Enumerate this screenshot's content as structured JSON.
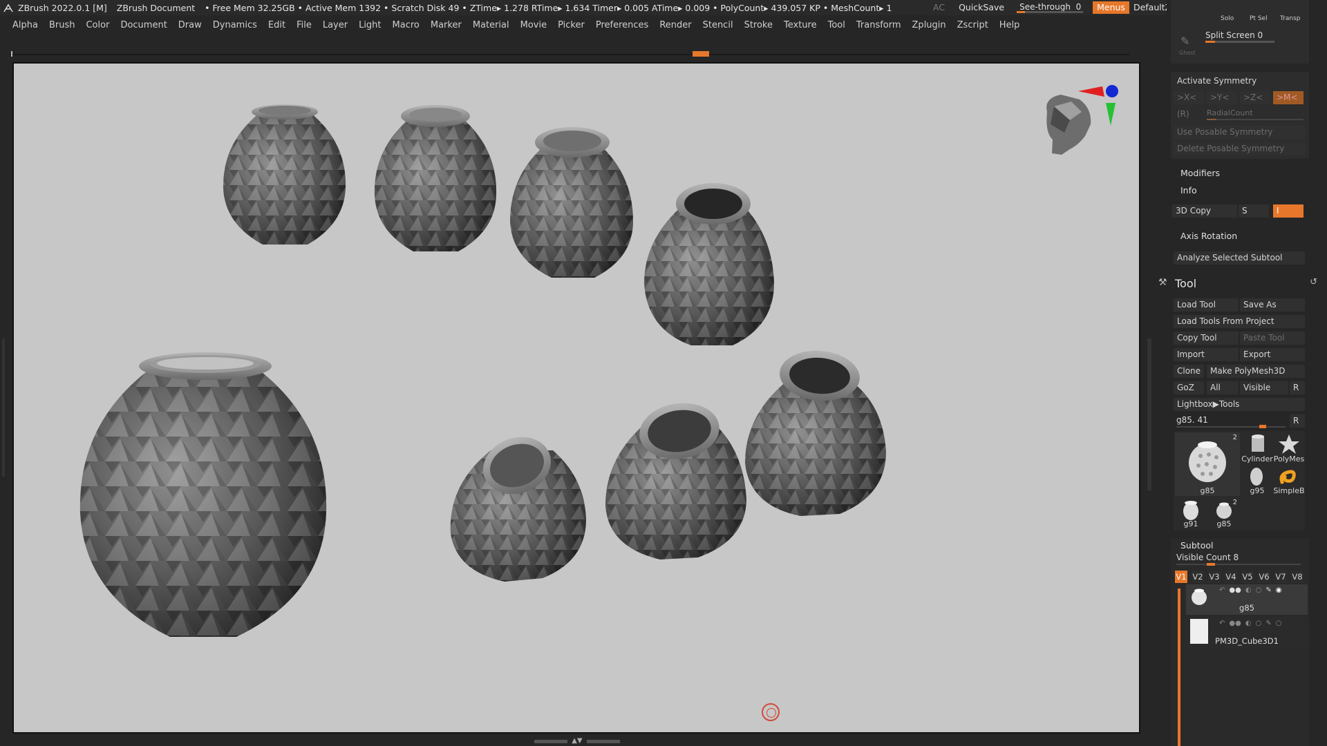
{
  "titlebar": {
    "app": "ZBrush 2022.0.1 [M]",
    "document": "ZBrush Document",
    "status": "• Free Mem 32.25GB • Active Mem 1392 • Scratch Disk 49 • ZTime▸ 1.278 RTime▸ 1.634 Timer▸ 0.005 ATime▸ 0.009 • PolyCount▸ 439.057 KP • MeshCount▸ 1",
    "ac": "AC",
    "quicksave": "QuickSave",
    "seethrough_label": "See-through",
    "seethrough_value": "0",
    "seethrough_level": 0,
    "menus": "Menus",
    "script": "DefaultZScript"
  },
  "menubar": [
    "Alpha",
    "Brush",
    "Color",
    "Document",
    "Draw",
    "Dynamics",
    "Edit",
    "File",
    "Layer",
    "Light",
    "Macro",
    "Marker",
    "Material",
    "Movie",
    "Picker",
    "Preferences",
    "Render",
    "Stencil",
    "Stroke",
    "Texture",
    "Tool",
    "Transform",
    "Zplugin",
    "Zscript",
    "Help"
  ],
  "top_right_panel": {
    "solo": "Solo",
    "ptsel": "Pt Sel",
    "transp": "Transp",
    "ghost": "Ghost",
    "split_screen_label": "Split Screen",
    "split_screen_value": "0"
  },
  "symmetry": {
    "title": "Activate Symmetry",
    "x": ">X<",
    "y": ">Y<",
    "z": ">Z<",
    "m": ">M<",
    "r": "(R)",
    "radial": "RadialCount",
    "use_posable": "Use Posable Symmetry",
    "delete_posable": "Delete Posable Symmetry"
  },
  "sections": {
    "modifiers": "Modifiers",
    "info": "Info",
    "copy3d": "3D Copy",
    "copy_s": "S",
    "copy_i": "I",
    "axis_rotation": "Axis Rotation",
    "analyze": "Analyze Selected Subtool"
  },
  "tool": {
    "title": "Tool",
    "load_tool": "Load Tool",
    "save_as": "Save As",
    "load_from_project": "Load Tools From Project",
    "copy_tool": "Copy Tool",
    "paste_tool": "Paste Tool",
    "import": "Import",
    "export": "Export",
    "clone": "Clone",
    "make_polymesh": "Make PolyMesh3D",
    "goz": "GoZ",
    "all": "All",
    "visible": "Visible",
    "r": "R",
    "lightbox": "Lightbox▶Tools",
    "current_tool": "g85. 41",
    "current_level": 0.72,
    "thumbs": {
      "main_label": "g85",
      "main_count": "2",
      "cylinder": "Cylinder",
      "polymesh": "PolyMes",
      "g95": "g95",
      "simpleb": "SimpleB",
      "g91": "g91",
      "g85": "g85",
      "g85_count": "2"
    }
  },
  "subtool": {
    "title": "Subtool",
    "visible_count_label": "Visible Count",
    "visible_count": "8",
    "visible_count_level": 0.3,
    "tabs": [
      "V1",
      "V2",
      "V3",
      "V4",
      "V5",
      "V6",
      "V7",
      "V8"
    ],
    "items": [
      {
        "name": "g85"
      },
      {
        "name": "PM3D_Cube3D1"
      }
    ]
  }
}
